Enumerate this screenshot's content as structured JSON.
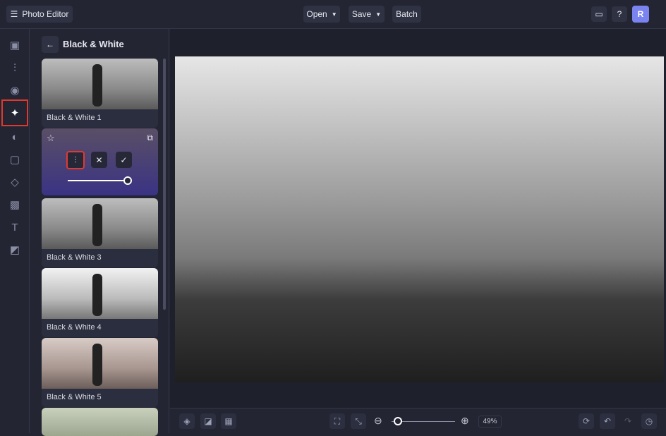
{
  "header": {
    "app_title": "Photo Editor",
    "open": "Open",
    "save": "Save",
    "batch": "Batch",
    "avatar": "R"
  },
  "panel": {
    "title": "Black & White",
    "items": [
      "Black & White 1",
      "Black & White 3",
      "Black & White 4",
      "Black & White 5"
    ]
  },
  "zoom": {
    "value": "49%",
    "slider_fraction": 0.05
  },
  "colors": {
    "accent": "#7b83f0",
    "highlight": "#e03a2e"
  }
}
